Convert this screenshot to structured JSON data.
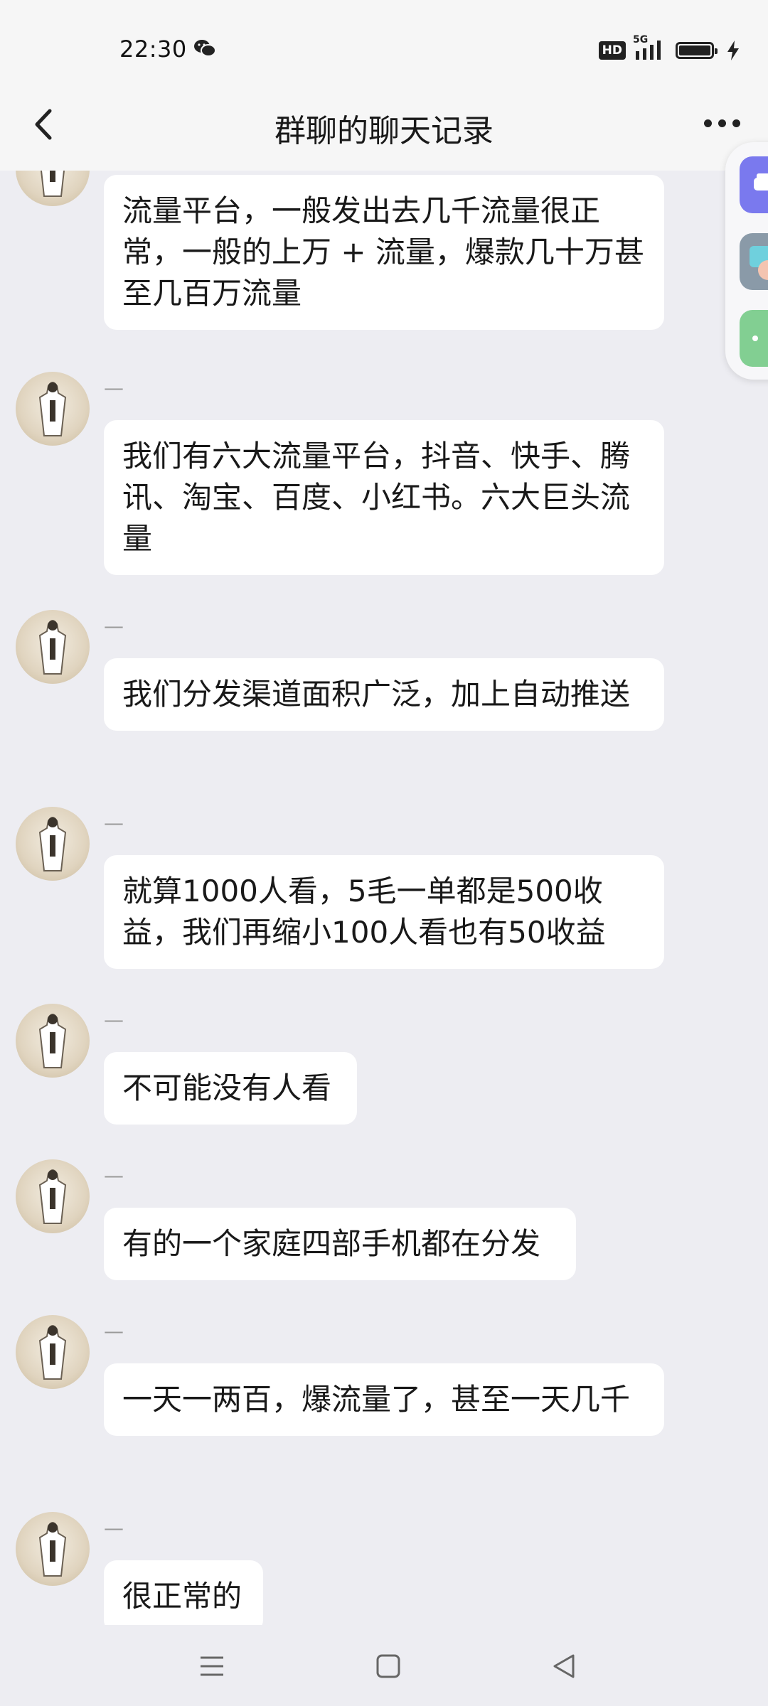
{
  "status_bar": {
    "time": "22:30",
    "network": "5G",
    "hd_badge": "HD",
    "icons": [
      "wechat-icon",
      "hd-icon",
      "signal-icon",
      "battery-icon",
      "charging-icon"
    ]
  },
  "header": {
    "title": "群聊的聊天记录",
    "back_icon": "chevron-left-icon",
    "more_icon": "more-dots-icon"
  },
  "messages": [
    {
      "sender": "",
      "text": "流量平台，一般发出去几千流量很正常，一般的上万 + 流量，爆款几十万甚至几百万流量"
    },
    {
      "sender": "—",
      "text": "我们有六大流量平台，抖音、快手、腾讯、淘宝、百度、小红书。六大巨头流量"
    },
    {
      "sender": "—",
      "text": "我们分发渠道面积广泛，加上自动推送"
    },
    {
      "sender": "—",
      "text": "就算1000人看，5毛一单都是500收益，我们再缩小100人看也有50收益"
    },
    {
      "sender": "—",
      "text": "不可能没有人看"
    },
    {
      "sender": "—",
      "text": "有的一个家庭四部手机都在分发"
    },
    {
      "sender": "—",
      "text": "一天一两百，爆流量了，甚至一天几千"
    },
    {
      "sender": "—",
      "text": "很正常的"
    }
  ],
  "floating_tabs": [
    "car-icon",
    "hand-icon",
    "more-dots-icon"
  ],
  "colors": {
    "background": "#ededf2",
    "bubble": "#ffffff",
    "header": "#f6f6f6"
  },
  "system_nav": [
    "menu-icon",
    "home-icon",
    "back-icon"
  ]
}
